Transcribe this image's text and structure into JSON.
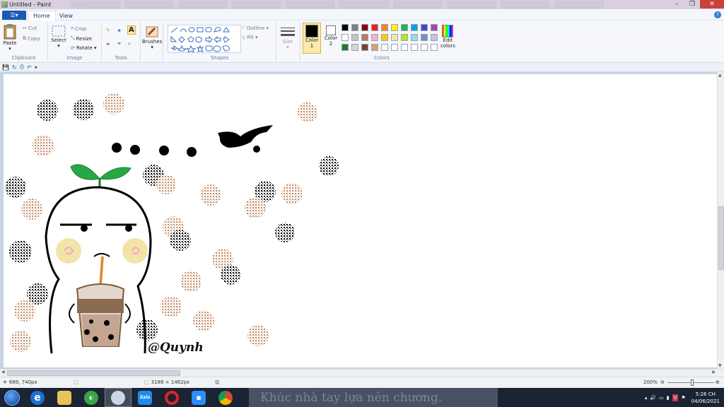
{
  "window": {
    "title": "Untitled - Paint"
  },
  "tabs": {
    "file": "▾",
    "home": "Home",
    "view": "View"
  },
  "clipboard": {
    "paste": "Paste",
    "cut": "Cut",
    "copy": "Copy",
    "label": "Clipboard"
  },
  "image": {
    "select": "Select",
    "crop": "Crop",
    "resize": "Resize",
    "rotate": "Rotate ▾",
    "label": "Image"
  },
  "tools": {
    "label": "Tools"
  },
  "brushes": {
    "label": "Brushes"
  },
  "shapes": {
    "label": "Shapes",
    "outline": "Outline ▾",
    "fill": "Fill ▾"
  },
  "size": {
    "label": "Size"
  },
  "colors": {
    "color1": "Color\n1",
    "color1_label": "Color",
    "color1_num": "1",
    "color2_label": "Color",
    "color2_num": "2",
    "edit": "Edit",
    "edit2": "colors",
    "label": "Colors",
    "palette_row1": [
      "#000000",
      "#7f7f7f",
      "#880015",
      "#ed1c24",
      "#ff7f27",
      "#fff200",
      "#22b14c",
      "#00a2e8",
      "#3f48cc",
      "#a349a4"
    ],
    "palette_row2": [
      "#ffffff",
      "#c3c3c3",
      "#b97a57",
      "#ffaec9",
      "#ffc90e",
      "#efe4b0",
      "#b5e61d",
      "#99d9ea",
      "#7092be",
      "#c8bfe7"
    ],
    "palette_row3": [
      "#1e7b2d",
      "#d4d4d4",
      "#6e4a2e",
      "#d9a07a",
      "",
      "",
      "",
      "",
      "",
      ""
    ]
  },
  "canvas": {
    "signature": "@Quynh"
  },
  "status": {
    "cursor": "689, 740px",
    "size": "3188 × 1462px",
    "zoom": "200%"
  },
  "taskbar": {
    "marquee": "Khúc nhà tay lựa nên chương.",
    "time": "5:26 CH",
    "date": "04/06/2021",
    "apps": [
      "Explorer",
      "Internet Explorer",
      "Files",
      "Paint.NET",
      "Paint",
      "Zalo",
      "Opera",
      "Zoom",
      "Chrome"
    ]
  }
}
